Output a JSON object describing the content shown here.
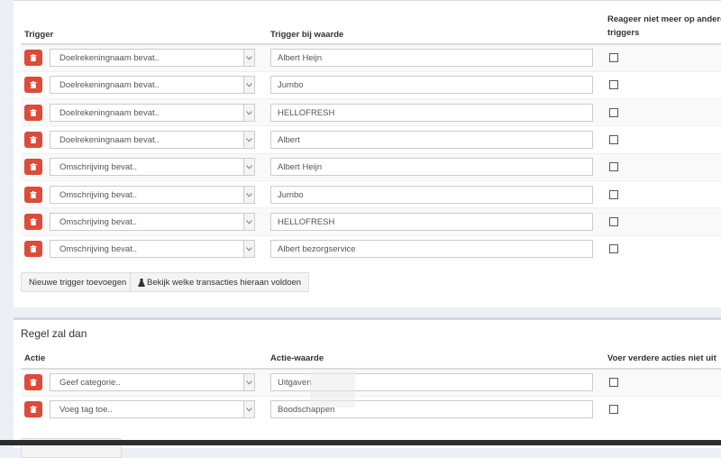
{
  "triggers": {
    "col_trigger": "Trigger",
    "col_value": "Trigger bij waarde",
    "col_stop": "Reageer niet meer op andere triggers",
    "rows": [
      {
        "type": "Doelrekeningnaam bevat..",
        "value": "Albert Heijn"
      },
      {
        "type": "Doelrekeningnaam bevat..",
        "value": "Jumbo"
      },
      {
        "type": "Doelrekeningnaam bevat..",
        "value": "HELLOFRESH"
      },
      {
        "type": "Doelrekeningnaam bevat..",
        "value": "Albert"
      },
      {
        "type": "Omschrijving bevat..",
        "value": "Albert Heijn"
      },
      {
        "type": "Omschrijving bevat..",
        "value": "Jumbo"
      },
      {
        "type": "Omschrijving bevat..",
        "value": "HELLOFRESH"
      },
      {
        "type": "Omschrijving bevat..",
        "value": "Albert bezorgservice"
      }
    ],
    "add_button": "Nieuwe trigger toevoegen",
    "test_button": "Bekijk welke transacties hieraan voldoen"
  },
  "actions": {
    "heading": "Regel zal dan",
    "col_action": "Actie",
    "col_value": "Actie-waarde",
    "col_stop": "Voer verdere acties niet uit",
    "rows": [
      {
        "type": "Geef categorie..",
        "value": "Uitgaven"
      },
      {
        "type": "Voeg tag toe..",
        "value": "Boodschappen"
      }
    ]
  },
  "colors": {
    "delete": "#dd4b39",
    "background": "#ecf0f5"
  }
}
